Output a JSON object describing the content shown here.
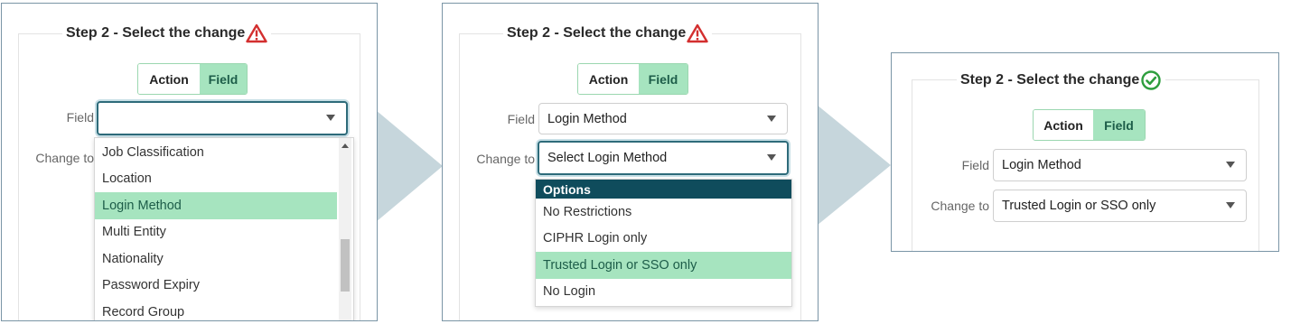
{
  "step_title": "Step 2 - Select the change",
  "toggle": {
    "action_label": "Action",
    "field_label": "Field"
  },
  "labels": {
    "field": "Field",
    "change_to": "Change to"
  },
  "colors": {
    "warning": "#d32f2f",
    "success": "#2e9e3e",
    "selected_bg": "#a6e4bf",
    "header_bg": "#0f4c5c",
    "arrow": "#c6d6dc"
  },
  "panel1": {
    "field_value": "",
    "status_icon": "warning-triangle-icon",
    "dropdown_items": [
      "Job Classification",
      "Location",
      "Login Method",
      "Multi Entity",
      "Nationality",
      "Password Expiry",
      "Record Group"
    ],
    "selected_item": "Login Method"
  },
  "panel2": {
    "status_icon": "warning-triangle-icon",
    "field_value": "Login Method",
    "change_to_value": "Select Login Method",
    "options_header": "Options",
    "options": [
      "No Restrictions",
      "CIPHR Login only",
      "Trusted Login or SSO only",
      "No Login"
    ],
    "selected_option": "Trusted Login or SSO only"
  },
  "panel3": {
    "status_icon": "check-circle-icon",
    "field_value": "Login Method",
    "change_to_value": "Trusted Login or SSO only"
  }
}
